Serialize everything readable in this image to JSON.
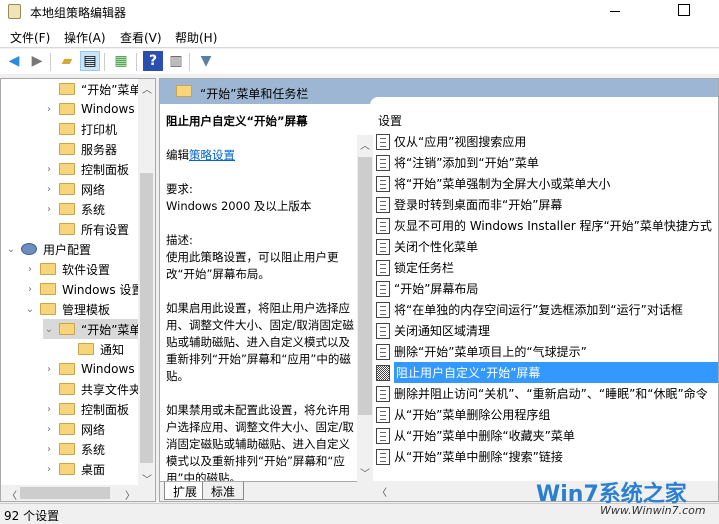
{
  "window": {
    "title": "本地组策略编辑器"
  },
  "menu": [
    "文件(F)",
    "操作(A)",
    "查看(V)",
    "帮助(H)"
  ],
  "tree": [
    {
      "label": "“开始”菜单",
      "chev": "",
      "indent": 2
    },
    {
      "label": "Windows",
      "chev": "›",
      "indent": 2
    },
    {
      "label": "打印机",
      "chev": "",
      "indent": 2
    },
    {
      "label": "服务器",
      "chev": "",
      "indent": 2
    },
    {
      "label": "控制面板",
      "chev": "›",
      "indent": 2
    },
    {
      "label": "网络",
      "chev": "›",
      "indent": 2
    },
    {
      "label": "系统",
      "chev": "›",
      "indent": 2
    },
    {
      "label": "所有设置",
      "chev": "",
      "indent": 2
    },
    {
      "label": "用户配置",
      "chev": "⌄",
      "indent": 0
    },
    {
      "label": "软件设置",
      "chev": "›",
      "indent": 1
    },
    {
      "label": "Windows 设置",
      "chev": "›",
      "indent": 1
    },
    {
      "label": "管理模板",
      "chev": "⌄",
      "indent": 1
    },
    {
      "label": "“开始”菜单",
      "chev": "⌄",
      "indent": 2
    },
    {
      "label": "通知",
      "chev": "",
      "indent": 3
    },
    {
      "label": "Windows",
      "chev": "›",
      "indent": 2
    },
    {
      "label": "共享文件夹",
      "chev": "",
      "indent": 2
    },
    {
      "label": "控制面板",
      "chev": "›",
      "indent": 2
    },
    {
      "label": "网络",
      "chev": "›",
      "indent": 2
    },
    {
      "label": "系统",
      "chev": "›",
      "indent": 2
    },
    {
      "label": "桌面",
      "chev": "›",
      "indent": 2
    }
  ],
  "header": {
    "title": "“开始”菜单和任务栏"
  },
  "description": {
    "title": "阻止用户自定义“开始”屏幕",
    "edit_prefix": "编辑",
    "edit_link": "策略设置",
    "req_label": "要求:",
    "req_value": "Windows 2000 及以上版本",
    "desc_label": "描述:",
    "desc_text": "使用此策略设置，可以阻止用户更改“开始”屏幕布局。",
    "enabled_text": "如果启用此设置，将阻止用户选择应用、调整文件大小、固定/取消固定磁贴或辅助磁贴、进入自定义模式以及重新排列“开始”屏幕和“应用”中的磁贴。",
    "disabled_text": "如果禁用或未配置此设置，将允许用户选择应用、调整文件大小、固定/取消固定磁贴或辅助磁贴、进入自定义模式以及重新排列“开始”屏幕和“应用”中的磁贴。"
  },
  "tabs": [
    "扩展",
    "标准"
  ],
  "list": {
    "header": "设置",
    "items": [
      "仅从“应用”视图搜索应用",
      "将“注销”添加到“开始”菜单",
      "将“开始”菜单强制为全屏大小或菜单大小",
      "登录时转到桌面而非“开始”屏幕",
      "灰显不可用的 Windows Installer 程序“开始”菜单快捷方式",
      "关闭个性化菜单",
      "锁定任务栏",
      "“开始”屏幕布局",
      "将“在单独的内存空间运行”复选框添加到“运行”对话框",
      "关闭通知区域清理",
      "删除“开始”菜单项目上的“气球提示”",
      "阻止用户自定义“开始”屏幕",
      "删除并阻止访问“关机”、“重新启动”、“睡眠”和“休眠”命令",
      "从“开始”菜单删除公用程序组",
      "从“开始”菜单中删除“收藏夹”菜单",
      "从“开始”菜单中删除“搜索”链接"
    ],
    "selected": 11
  },
  "status": "92 个设置",
  "watermark": {
    "logo": "Win7系统之家",
    "url": "Www.Winwin7.com"
  }
}
